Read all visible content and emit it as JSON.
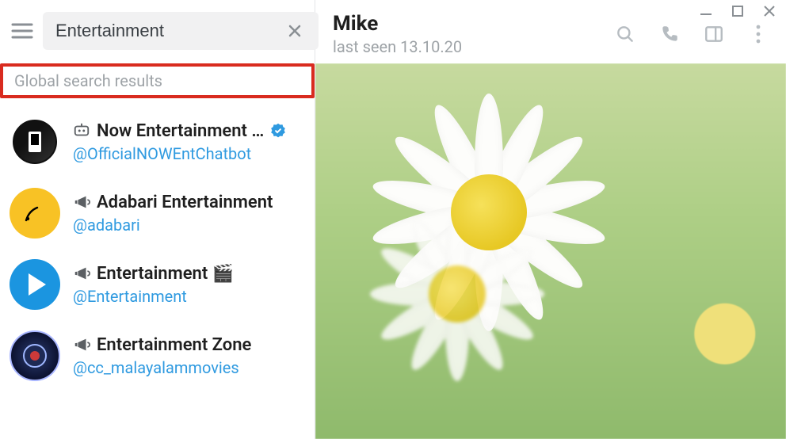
{
  "search": {
    "value": "Entertainment"
  },
  "results_header": "Global search results",
  "results": [
    {
      "type": "bot",
      "name": "Now Entertainment …",
      "handle": "@OfficialNOWEntChatbot",
      "verified": true,
      "avatar": "black"
    },
    {
      "type": "channel",
      "name": "Adabari Entertainment",
      "handle": "@adabari",
      "verified": false,
      "avatar": "yellow"
    },
    {
      "type": "channel",
      "name": "Entertainment 🎬",
      "handle": "@Entertainment",
      "verified": false,
      "avatar": "blue"
    },
    {
      "type": "channel",
      "name": "Entertainment Zone",
      "handle": "@cc_malayalammovies",
      "verified": false,
      "avatar": "dark"
    }
  ],
  "chat": {
    "title": "Mike",
    "subtitle": "last seen 13.10.20"
  }
}
